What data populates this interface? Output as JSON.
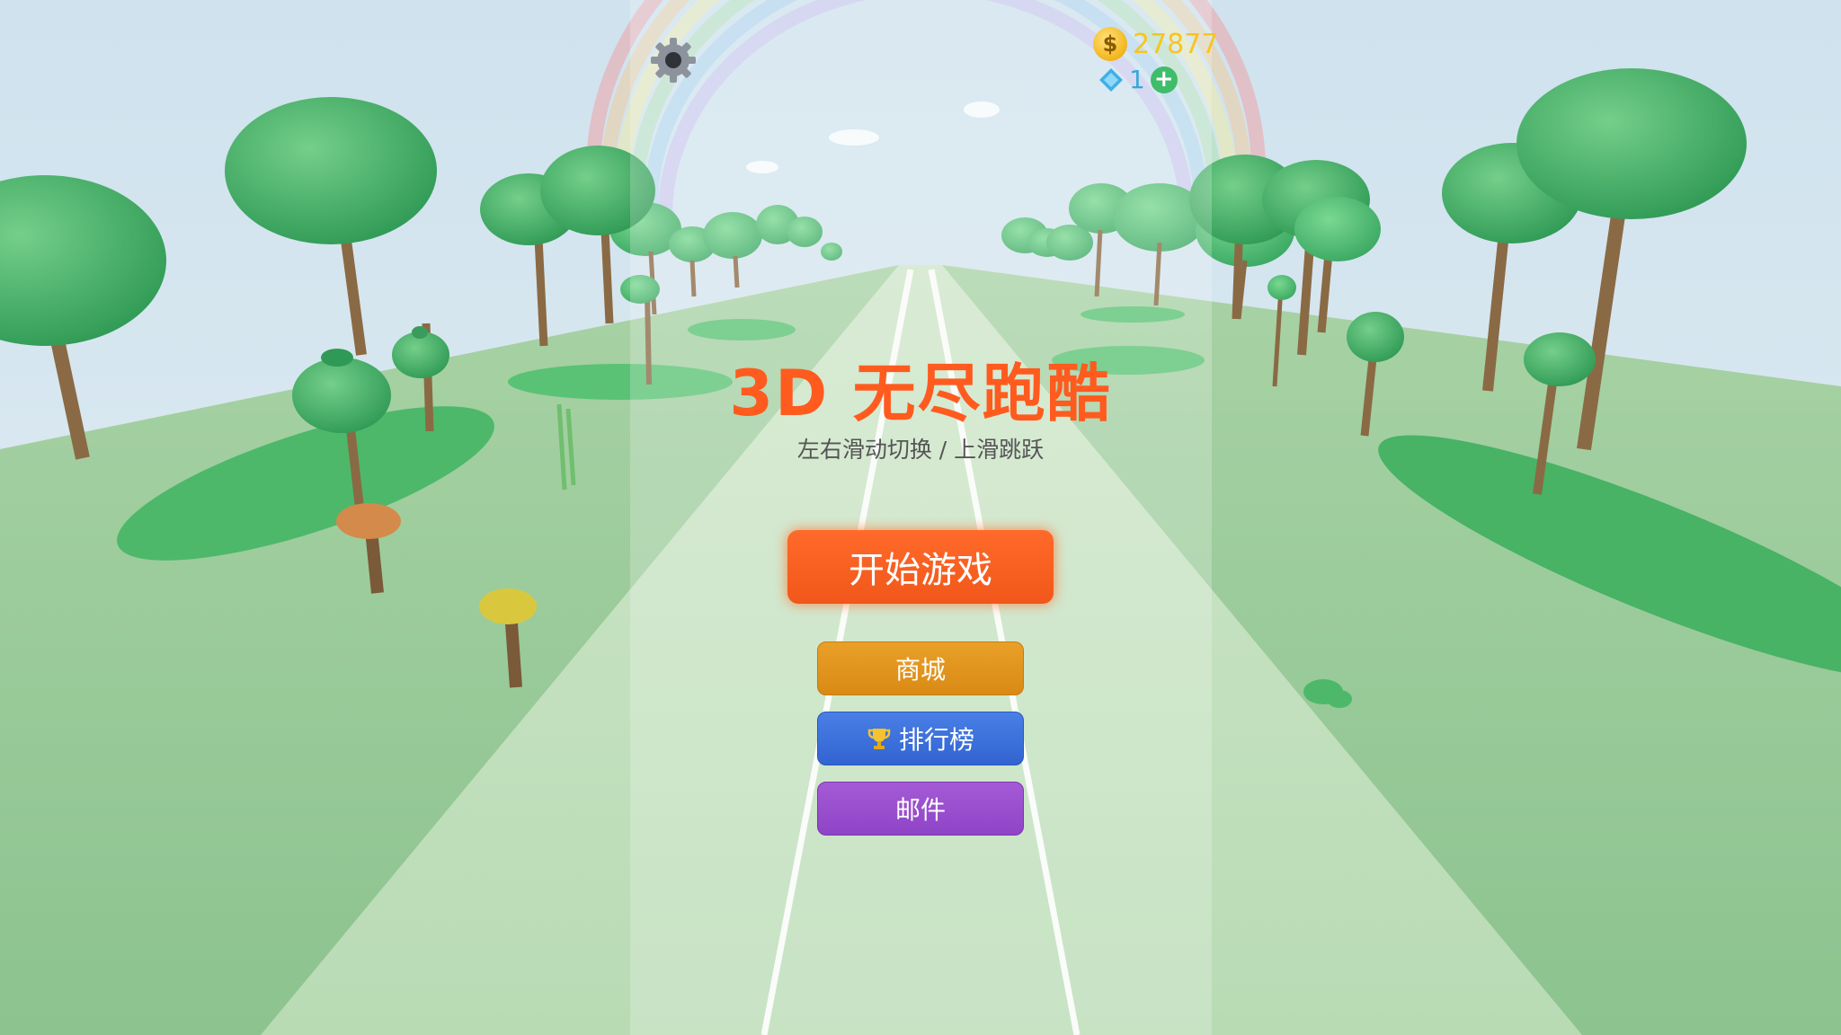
{
  "hud": {
    "coins": "27877",
    "coin_symbol": "$",
    "gems": "1",
    "add_symbol": "+"
  },
  "title": "3D 无尽跑酷",
  "subtitle": "左右滑动切换 / 上滑跳跃",
  "buttons": {
    "start": "开始游戏",
    "shop": "商城",
    "leaderboard": "排行榜",
    "mail": "邮件"
  },
  "icons": {
    "settings": "gear-icon",
    "coin": "coin-icon",
    "gem": "diamond-icon",
    "add": "plus-icon",
    "leaderboard": "trophy-icon"
  },
  "colors": {
    "title": "#ff5b1f",
    "start_button": "#f1571a",
    "shop_button": "#d98a15",
    "leaderboard_button": "#3164d0",
    "mail_button": "#8e44c6",
    "coin_text": "#f6c51e",
    "gem_text": "#35a9d9"
  }
}
